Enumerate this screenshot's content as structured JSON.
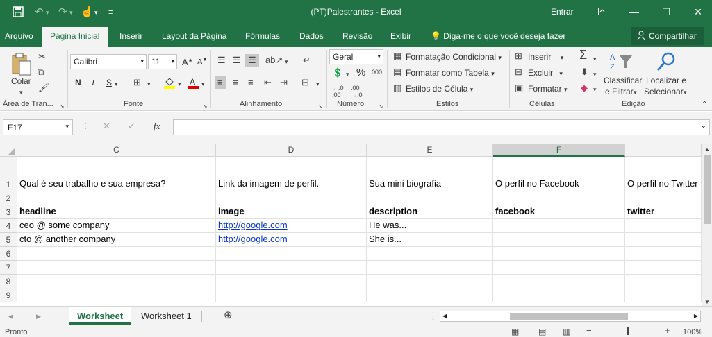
{
  "window": {
    "title": "(PT)Palestrantes  -  Excel",
    "signin": "Entrar",
    "minimize_glyph": "—",
    "restore_glyph": "▭",
    "maximize_glyph": "☐",
    "close_glyph": "✕"
  },
  "quick_access": {
    "save_icon": "save-icon",
    "undo_icon": "undo-icon",
    "redo_icon": "redo-icon",
    "touch_icon": "touch-mode-icon"
  },
  "tabs": [
    "Arquivo",
    "Página Inicial",
    "Inserir",
    "Layout da Página",
    "Fórmulas",
    "Dados",
    "Revisão",
    "Exibir"
  ],
  "tell_me": "Diga-me o que você deseja fazer",
  "share": "Compartilhar",
  "ribbon": {
    "clipboard": {
      "paste": "Colar",
      "group": "Área de Tran..."
    },
    "font": {
      "name": "Calibri",
      "size": "11",
      "bold": "N",
      "italic": "I",
      "underline": "S",
      "group": "Fonte"
    },
    "alignment": {
      "group": "Alinhamento"
    },
    "number": {
      "format": "Geral",
      "percent": "%",
      "thousands": "000",
      "group": "Número"
    },
    "styles": {
      "conditional": "Formatação Condicional",
      "as_table": "Formatar como Tabela",
      "cell_styles": "Estilos de Célula",
      "group": "Estilos"
    },
    "cells": {
      "insert": "Inserir",
      "delete": "Excluir",
      "format": "Formatar",
      "group": "Células"
    },
    "editing": {
      "sort1": "Classificar",
      "sort2": "e Filtrar",
      "find1": "Localizar e",
      "find2": "Selecionar",
      "group": "Edição"
    }
  },
  "formula_bar": {
    "name_box": "F17",
    "fx": "fx",
    "content": ""
  },
  "grid": {
    "columns": [
      "C",
      "D",
      "E",
      "F"
    ],
    "partial_column_letter": "",
    "selected_column": "F",
    "rows": [
      {
        "num": "1",
        "cells": [
          "Qual é seu trabalho e sua empresa?",
          "Link da imagem de perfil.",
          "Sua mini biografia",
          "O perfil no Facebook",
          "O perfil no Twitter"
        ]
      },
      {
        "num": "2",
        "cells": [
          "",
          "",
          "",
          "",
          ""
        ]
      },
      {
        "num": "3",
        "cells": [
          "headline",
          "image",
          "description",
          "facebook",
          "twitter"
        ]
      },
      {
        "num": "4",
        "cells": [
          "ceo @ some company",
          "http://google.com",
          "He was...",
          "",
          ""
        ]
      },
      {
        "num": "5",
        "cells": [
          "cto @ another company",
          "http://google.com",
          "She is...",
          "",
          ""
        ]
      },
      {
        "num": "6",
        "cells": [
          "",
          "",
          "",
          "",
          ""
        ]
      },
      {
        "num": "7",
        "cells": [
          "",
          "",
          "",
          "",
          ""
        ]
      },
      {
        "num": "8",
        "cells": [
          "",
          "",
          "",
          "",
          ""
        ]
      },
      {
        "num": "9",
        "cells": [
          "",
          "",
          "",
          "",
          ""
        ]
      }
    ]
  },
  "sheets": {
    "active": "Worksheet",
    "other": "Worksheet 1"
  },
  "status": {
    "ready": "Pronto",
    "zoom": "100%",
    "minus": "−",
    "plus": "+"
  }
}
